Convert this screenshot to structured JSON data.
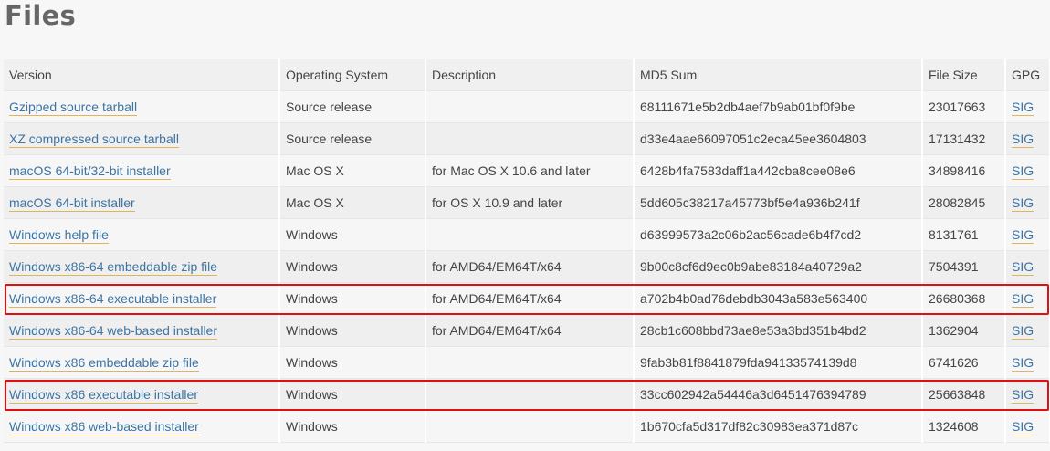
{
  "page_title": "Files",
  "columns": [
    "Version",
    "Operating System",
    "Description",
    "MD5 Sum",
    "File Size",
    "GPG"
  ],
  "rows": [
    {
      "version": "Gzipped source tarball",
      "os": "Source release",
      "description": "",
      "md5": "68111671e5b2db4aef7b9ab01bf0f9be",
      "size": "23017663",
      "gpg": "SIG"
    },
    {
      "version": "XZ compressed source tarball",
      "os": "Source release",
      "description": "",
      "md5": "d33e4aae66097051c2eca45ee3604803",
      "size": "17131432",
      "gpg": "SIG"
    },
    {
      "version": "macOS 64-bit/32-bit installer",
      "os": "Mac OS X",
      "description": "for Mac OS X 10.6 and later",
      "md5": "6428b4fa7583daff1a442cba8cee08e6",
      "size": "34898416",
      "gpg": "SIG"
    },
    {
      "version": "macOS 64-bit installer",
      "os": "Mac OS X",
      "description": "for OS X 10.9 and later",
      "md5": "5dd605c38217a45773bf5e4a936b241f",
      "size": "28082845",
      "gpg": "SIG"
    },
    {
      "version": "Windows help file",
      "os": "Windows",
      "description": "",
      "md5": "d63999573a2c06b2ac56cade6b4f7cd2",
      "size": "8131761",
      "gpg": "SIG"
    },
    {
      "version": "Windows x86-64 embeddable zip file",
      "os": "Windows",
      "description": "for AMD64/EM64T/x64",
      "md5": "9b00c8cf6d9ec0b9abe83184a40729a2",
      "size": "7504391",
      "gpg": "SIG"
    },
    {
      "version": "Windows x86-64 executable installer",
      "os": "Windows",
      "description": "for AMD64/EM64T/x64",
      "md5": "a702b4b0ad76debdb3043a583e563400",
      "size": "26680368",
      "gpg": "SIG"
    },
    {
      "version": "Windows x86-64 web-based installer",
      "os": "Windows",
      "description": "for AMD64/EM64T/x64",
      "md5": "28cb1c608bbd73ae8e53a3bd351b4bd2",
      "size": "1362904",
      "gpg": "SIG"
    },
    {
      "version": "Windows x86 embeddable zip file",
      "os": "Windows",
      "description": "",
      "md5": "9fab3b81f8841879fda94133574139d8",
      "size": "6741626",
      "gpg": "SIG"
    },
    {
      "version": "Windows x86 executable installer",
      "os": "Windows",
      "description": "",
      "md5": "33cc602942a54446a3d6451476394789",
      "size": "25663848",
      "gpg": "SIG"
    },
    {
      "version": "Windows x86 web-based installer",
      "os": "Windows",
      "description": "",
      "md5": "1b670cfa5d317df82c30983ea371d87c",
      "size": "1324608",
      "gpg": "SIG"
    }
  ],
  "highlighted_rows": [
    6,
    9
  ],
  "colors": {
    "link": "#3c74a3",
    "link_underline": "#e0b45a",
    "highlight": "#e01010"
  }
}
